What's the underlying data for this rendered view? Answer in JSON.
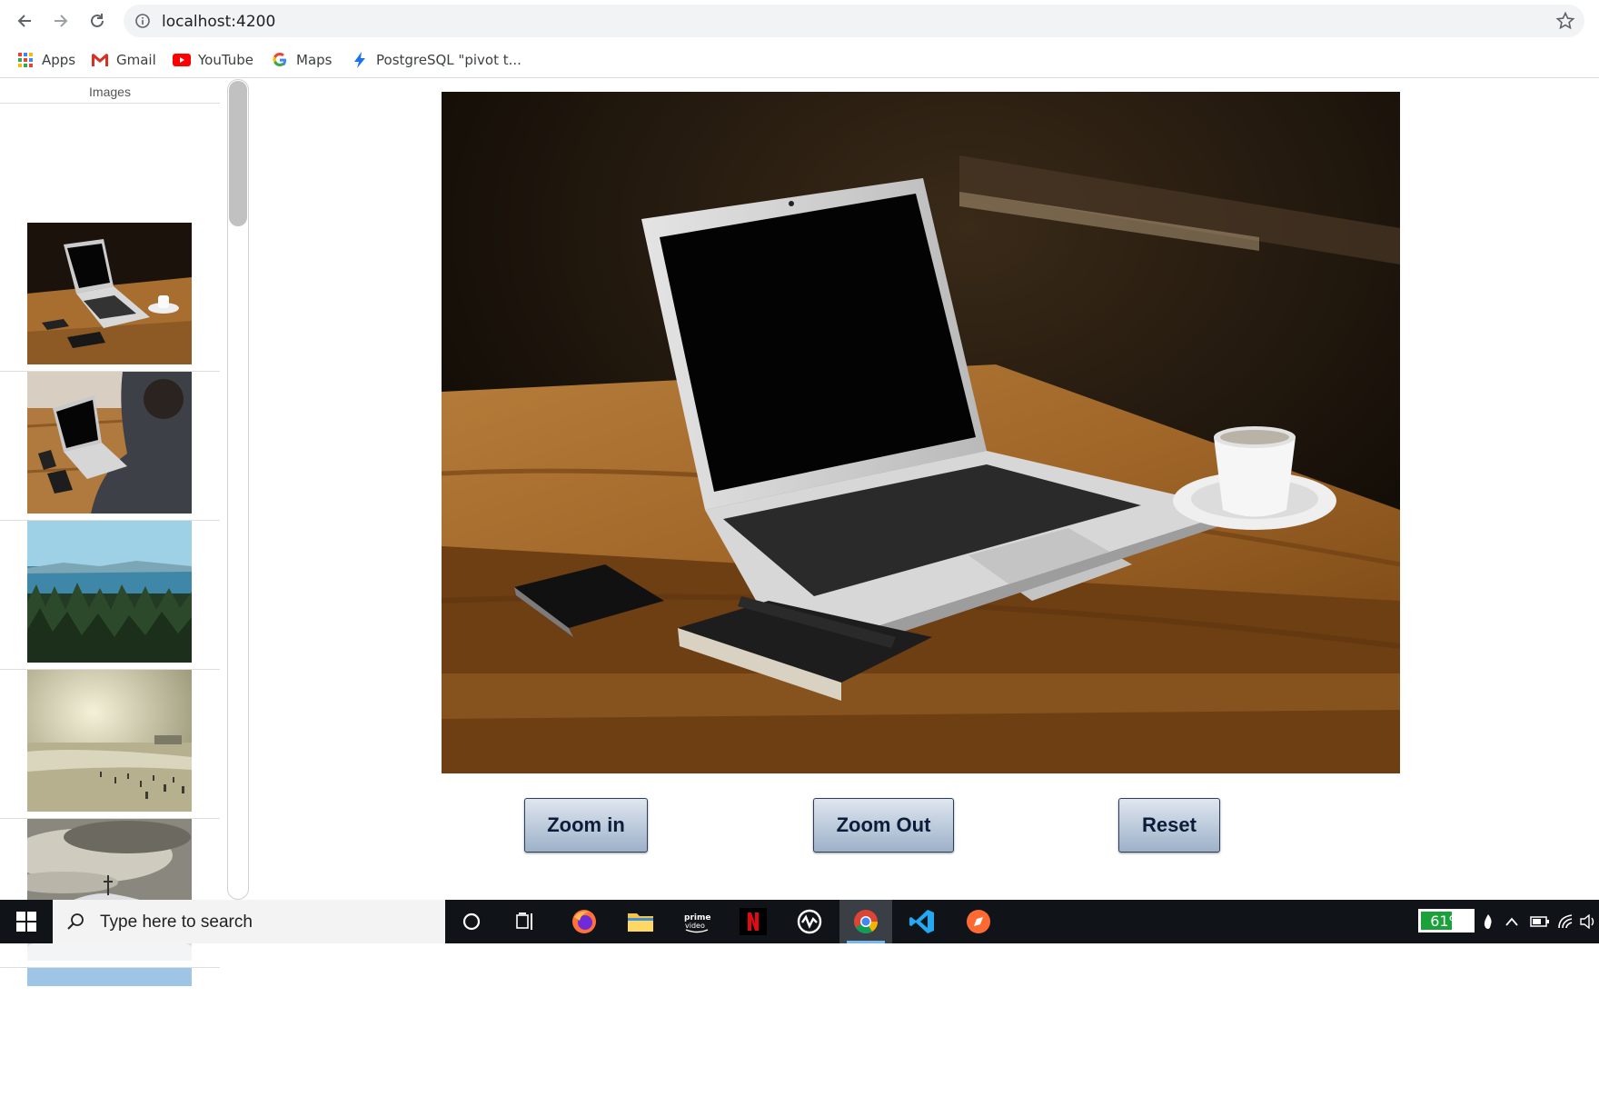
{
  "browser": {
    "url": "localhost:4200",
    "bookmarks": [
      {
        "label": "Apps",
        "icon": "apps-grid-icon"
      },
      {
        "label": "Gmail",
        "icon": "gmail-icon"
      },
      {
        "label": "YouTube",
        "icon": "youtube-icon"
      },
      {
        "label": "Maps",
        "icon": "google-icon"
      },
      {
        "label": "PostgreSQL \"pivot t...",
        "icon": "bolt-icon"
      }
    ]
  },
  "sidebar": {
    "title": "Images",
    "thumbnails": [
      {
        "subject": "laptop-on-table"
      },
      {
        "subject": "person-typing-laptop"
      },
      {
        "subject": "forest-lake"
      },
      {
        "subject": "beach-crowd"
      },
      {
        "subject": "snowy-hill"
      }
    ]
  },
  "main": {
    "image_subject": "laptop-on-wooden-table",
    "buttons": {
      "zoom_in": "Zoom in",
      "zoom_out": "Zoom Out",
      "reset": "Reset"
    }
  },
  "taskbar": {
    "search_placeholder": "Type here to search",
    "battery_percent": "61%",
    "battery_level": 0.61,
    "apps": [
      "cortana",
      "task-view",
      "firefox",
      "file-explorer",
      "prime-video",
      "netflix",
      "network-app",
      "chrome",
      "vscode",
      "browser-app"
    ]
  },
  "colors": {
    "button_text": "#0b1d3a",
    "taskbar": "#101419",
    "battery_green": "#1aa13a"
  }
}
